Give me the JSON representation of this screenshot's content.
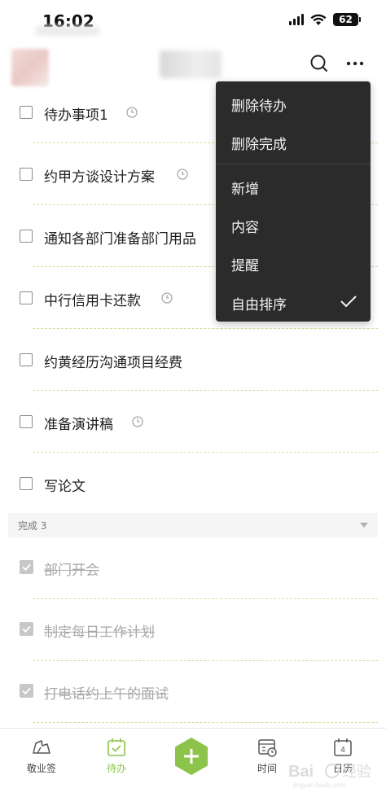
{
  "status_bar": {
    "time": "16:02",
    "battery": "62"
  },
  "header": {
    "avatar_icon": "blurred-avatar",
    "search_icon": "search-icon",
    "more_icon": "more-dots-icon"
  },
  "todos": [
    {
      "label": "待办事项1",
      "has_reminder": true
    },
    {
      "label": "约甲方谈设计方案",
      "has_reminder": true
    },
    {
      "label": "通知各部门准备部门用品",
      "has_reminder": false
    },
    {
      "label": "中行信用卡还款",
      "has_reminder": true
    },
    {
      "label": "约黄经历沟通项目经费",
      "has_reminder": false
    },
    {
      "label": "准备演讲稿",
      "has_reminder": true
    },
    {
      "label": "写论文",
      "has_reminder": false
    }
  ],
  "done_section": {
    "label": "完成 3"
  },
  "done_items": [
    {
      "label": "部门开会"
    },
    {
      "label": "制定每日工作计划"
    },
    {
      "label": "打电话约上午的面试"
    }
  ],
  "menu": {
    "items": [
      "删除待办",
      "删除完成",
      "新增",
      "内容",
      "提醒",
      "自由排序"
    ],
    "checked_item": "自由排序"
  },
  "tabs": [
    {
      "label": "敬业签",
      "icon": "sign-icon",
      "active": false
    },
    {
      "label": "待办",
      "icon": "todo-calendar-check-icon",
      "active": true
    },
    {
      "label": "",
      "icon": "add-hexagon-icon",
      "active": false
    },
    {
      "label": "时间",
      "icon": "time-calendar-icon",
      "active": false
    },
    {
      "label": "日历",
      "icon": "calendar-icon",
      "active": false
    }
  ],
  "colors": {
    "accent": "#8cc34a",
    "menu_bg": "#2b2b2b",
    "divider": "#cfe39c"
  }
}
